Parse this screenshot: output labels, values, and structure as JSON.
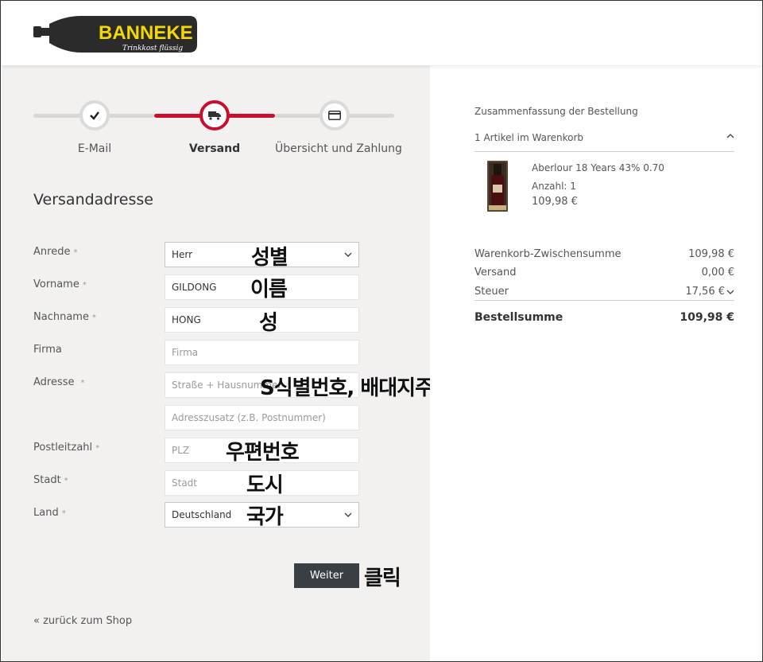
{
  "header": {
    "brand": "BANNEKE",
    "tagline": "Trinkkost flüssig"
  },
  "stepper": {
    "steps": [
      {
        "label": "E-Mail",
        "state": "done",
        "icon": "check-icon"
      },
      {
        "label": "Versand",
        "state": "active",
        "icon": "truck-icon"
      },
      {
        "label": "Übersicht und Zahlung",
        "state": "todo",
        "icon": "credit-card-icon"
      }
    ]
  },
  "form": {
    "title": "Versandadresse",
    "req_mark": "*",
    "fields": {
      "anrede": {
        "label": "Anrede",
        "value": "Herr"
      },
      "vorname": {
        "label": "Vorname",
        "value": "GILDONG"
      },
      "nachname": {
        "label": "Nachname",
        "value": "HONG"
      },
      "firma": {
        "label": "Firma",
        "placeholder": "Firma"
      },
      "adresse": {
        "label": "Adresse",
        "placeholder": "Straße + Hausnummer"
      },
      "adresszusatz": {
        "placeholder": "Adresszusatz (z.B. Postnummer)"
      },
      "plz": {
        "label": "Postleitzahl",
        "placeholder": "PLZ"
      },
      "stadt": {
        "label": "Stadt",
        "placeholder": "Stadt"
      },
      "land": {
        "label": "Land",
        "value": "Deutschland"
      }
    },
    "submit_label": "Weiter",
    "back_link": "« zurück zum Shop"
  },
  "annotations": {
    "anrede": "성별",
    "vorname": "이름",
    "nachname": "성",
    "adresse": "S식별번호, 배대지주소",
    "plz": "우편번호",
    "stadt": "도시",
    "land": "국가",
    "weiter": "클릭"
  },
  "summary": {
    "title": "Zusammenfassung der Bestellung",
    "cart_count": "1 Artikel im Warenkorb",
    "product": {
      "name": "Aberlour 18 Years 43% 0.70",
      "qty": "Anzahl: 1",
      "price": "109,98 €"
    },
    "rows": {
      "subtotal": {
        "label": "Warenkorb-Zwischensumme",
        "value": "109,98 €"
      },
      "shipping": {
        "label": "Versand",
        "value": "0,00 €"
      },
      "tax": {
        "label": "Steuer",
        "value": "17,56 €"
      },
      "total": {
        "label": "Bestellsumme",
        "value": "109,98 €"
      }
    }
  },
  "colors": {
    "accent": "#c8102e",
    "panel_bg": "#f3f1ef",
    "button_bg": "#3a3f44",
    "logo_yellow": "#f5d800"
  }
}
